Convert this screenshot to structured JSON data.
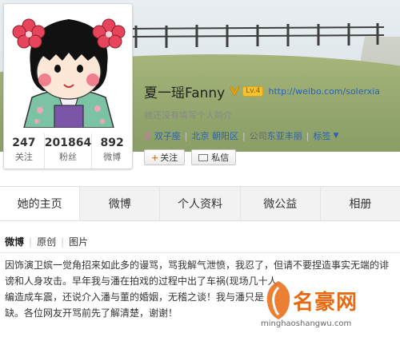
{
  "profile": {
    "name": "夏一瑶Fanny",
    "level_badge": "Lv.4",
    "url": "http://weibo.com/solerxia",
    "bio": "她还没有填写个人简介",
    "meta": {
      "zodiac": "双子座",
      "location": "北京 朝阳区",
      "company_prefix": "公司",
      "company": "东亚丰丽",
      "tags": "标签"
    },
    "buttons": {
      "follow": "关注",
      "message": "私信"
    }
  },
  "stats": [
    {
      "value": "247",
      "label": "关注"
    },
    {
      "value": "201864",
      "label": "粉丝"
    },
    {
      "value": "892",
      "label": "微博"
    }
  ],
  "tabs": [
    "她的主页",
    "微博",
    "个人资料",
    "微公益",
    "相册"
  ],
  "filter": [
    "微博",
    "原创",
    "图片"
  ],
  "post": {
    "lines": [
      "因饰演卫嫔一觉角招来如此多的谩骂，骂我解气泄愤，我忍了，但请不要捏造事实无端的诽",
      "谤和人身攻击。早年我与潘在拍戏的过程中出了车祸(现场几十人",
      "编造成车震，还说介入潘与董的婚姻，无稽之谈！我与潘只是",
      "缺。各位网友开骂前先了解清楚，谢谢！"
    ]
  },
  "watermark": {
    "title": "名豪网",
    "url": "minghaoshangwu.com"
  },
  "colors": {
    "link": "#2a62b3",
    "accent_orange": "#ee7b00",
    "watermark": "#e76a12"
  }
}
